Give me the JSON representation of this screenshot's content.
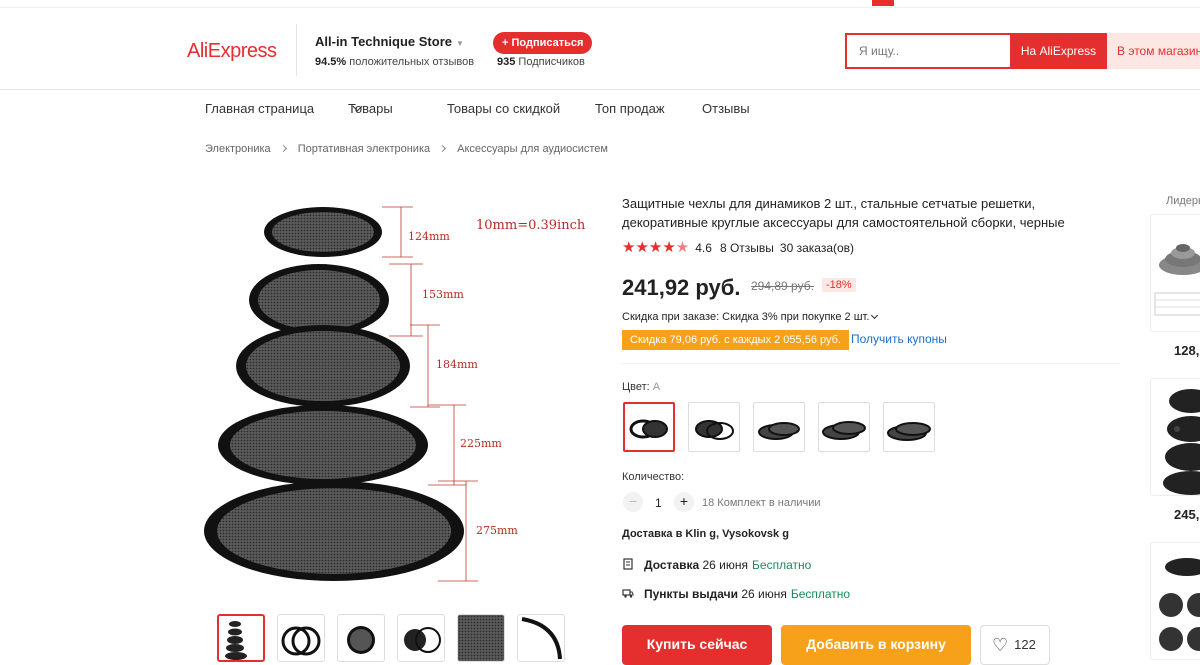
{
  "header": {
    "logo": "AliExpress",
    "store": {
      "name": "All-in Technique Store",
      "rating_value": "94.5%",
      "rating_text": "положительных отзывов",
      "subscribe_label": "+ Подписаться",
      "subscribers_value": "935",
      "subscribers_text": "Подписчиков"
    },
    "search": {
      "placeholder": "Я ищу..",
      "on_aliexpress": "На AliExpress",
      "in_store": "В этом магазине"
    }
  },
  "nav": {
    "items": [
      "Главная страница",
      "Товары",
      "Товары со скидкой",
      "Топ продаж",
      "Отзывы"
    ]
  },
  "breadcrumb": [
    "Электроника",
    "Портативная электроника",
    "Аксессуары для аудиосистем"
  ],
  "gallery": {
    "scale_note": "10mm=0.39inch",
    "sizes": [
      "124mm",
      "153mm",
      "184mm",
      "225mm",
      "275mm"
    ]
  },
  "product": {
    "title": "Защитные чехлы для динамиков 2 шт., стальные сетчатые решетки, декоративные круглые аксессуары для самостоятельной сборки, черные",
    "rating": 4.6,
    "rating_text": "4.6",
    "reviews": "8 Отзывы",
    "orders": "30 заказа(ов)",
    "price": "241,92 руб.",
    "old_price": "294,89 руб.",
    "discount": "-18%",
    "bulk_discount": "Скидка при заказе: Скидка 3% при покупке 2 шт.",
    "coupon": "Скидка 79,06 руб. с каждых 2 055,56 руб.",
    "get_coupons": "Получить купоны",
    "color_label": "Цвет:",
    "color_value": "A",
    "quantity_label": "Количество:",
    "quantity": "1",
    "stock": "18 Комплект в наличии",
    "ship_to": "Доставка в Klin g, Vysokovsk g",
    "delivery": {
      "label": "Доставка",
      "date": "26 июня",
      "price": "Бесплатно"
    },
    "pickup": {
      "label": "Пункты выдачи",
      "date": "26 июня",
      "price": "Бесплатно"
    },
    "buy_now": "Купить сейчас",
    "add_to_cart": "Добавить в корзину",
    "wishlist_count": "122"
  },
  "sidebar": {
    "title": "Лидеры продаж",
    "prices": [
      "128,",
      "245,"
    ]
  },
  "colors": {
    "accent": "#e52e2e",
    "orange": "#f7a11a",
    "link": "#1a6fc8",
    "free": "#1b8a59"
  }
}
